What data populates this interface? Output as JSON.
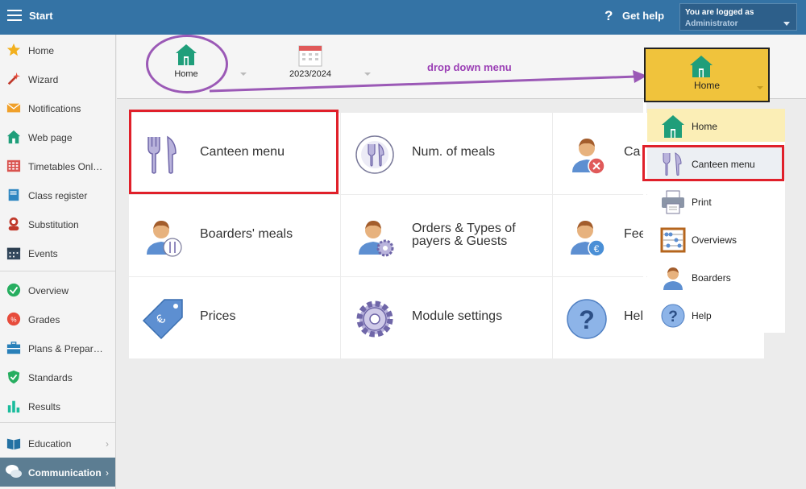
{
  "topbar": {
    "start_label": "Start",
    "help_label": "Get help",
    "login_line1": "You are logged as",
    "login_line2": "Administrator"
  },
  "sidebar": {
    "items": [
      {
        "label": "Home",
        "icon": "star-icon"
      },
      {
        "label": "Wizard",
        "icon": "wand-icon"
      },
      {
        "label": "Notifications",
        "icon": "envelope-icon"
      },
      {
        "label": "Web page",
        "icon": "house-icon"
      },
      {
        "label": "Timetables Onl…",
        "icon": "timetable-icon"
      },
      {
        "label": "Class register",
        "icon": "book-icon"
      },
      {
        "label": "Substitution",
        "icon": "person-icon"
      },
      {
        "label": "Events",
        "icon": "calendar-icon"
      },
      {
        "label": "Overview",
        "icon": "check-circle-icon"
      },
      {
        "label": "Grades",
        "icon": "grades-icon"
      },
      {
        "label": "Plans & Prepar…",
        "icon": "briefcase-icon"
      },
      {
        "label": "Standards",
        "icon": "shield-icon"
      },
      {
        "label": "Results",
        "icon": "bar-chart-icon"
      },
      {
        "label": "Education",
        "icon": "open-book-icon"
      },
      {
        "label": "Communication",
        "icon": "chat-icon"
      }
    ]
  },
  "header": {
    "home_label": "Home",
    "year_label": "2023/2024",
    "annotation": "drop down menu"
  },
  "tiles": [
    {
      "label": "Canteen menu",
      "icon": "fork-knife-icon"
    },
    {
      "label": "Num. of meals",
      "icon": "plate-icon"
    },
    {
      "label": "Ca",
      "icon": "person-cancel-icon"
    },
    {
      "label": "Boarders' meals",
      "icon": "boarder-meal-icon"
    },
    {
      "label": "Orders & Types of payers & Guests",
      "icon": "person-gear-icon"
    },
    {
      "label": "Fee",
      "icon": "person-euro-icon"
    },
    {
      "label": "Prices",
      "icon": "price-tag-icon"
    },
    {
      "label": "Module settings",
      "icon": "gear-icon"
    },
    {
      "label": "Hel",
      "icon": "help-circle-icon"
    }
  ],
  "dropdown": {
    "button_label": "Home",
    "items": [
      {
        "label": "Home",
        "icon": "house-icon"
      },
      {
        "label": "Canteen menu",
        "icon": "fork-knife-icon"
      },
      {
        "label": "Print",
        "icon": "printer-icon"
      },
      {
        "label": "Overviews",
        "icon": "abacus-icon"
      },
      {
        "label": "Boarders",
        "icon": "person-icon"
      },
      {
        "label": "Help",
        "icon": "help-circle-icon"
      }
    ]
  },
  "colors": {
    "topbar": "#3473a5",
    "highlight_red": "#e0202a",
    "annotation_purple": "#9b59b6",
    "dropdown_yellow": "#f0c33c",
    "icon_purple": "#8b7fc4"
  }
}
